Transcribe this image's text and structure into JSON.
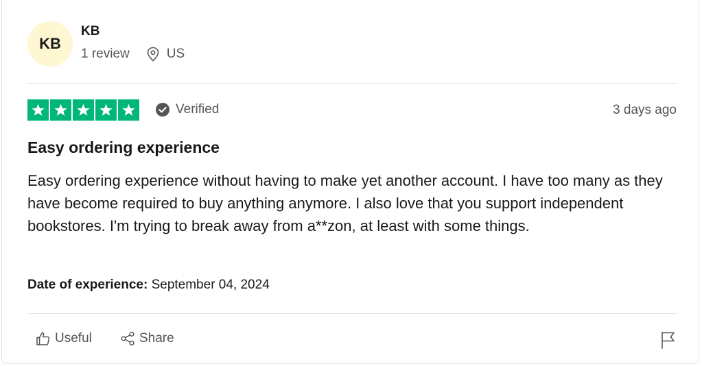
{
  "consumer": {
    "initials": "KB",
    "name": "KB",
    "review_count": "1 review",
    "country": "US"
  },
  "review": {
    "rating": 5,
    "max_rating": 5,
    "verified_label": "Verified",
    "date_posted": "3 days ago",
    "title": "Easy ordering experience",
    "text": "Easy ordering experience without having to make yet another account. I have too many as they have become required to buy anything anymore. I also love that you support independent bookstores. I'm trying to break away from a**zon, at least with some things.",
    "experience_label": "Date of experience:",
    "experience_date": "September 04, 2024"
  },
  "actions": {
    "useful_label": "Useful",
    "share_label": "Share"
  },
  "colors": {
    "star_green": "#00b67a",
    "avatar_bg": "#fff7d1"
  },
  "icons": [
    "location-pin-icon",
    "star-icon",
    "verified-check-icon",
    "thumbs-up-icon",
    "share-icon",
    "flag-icon"
  ]
}
